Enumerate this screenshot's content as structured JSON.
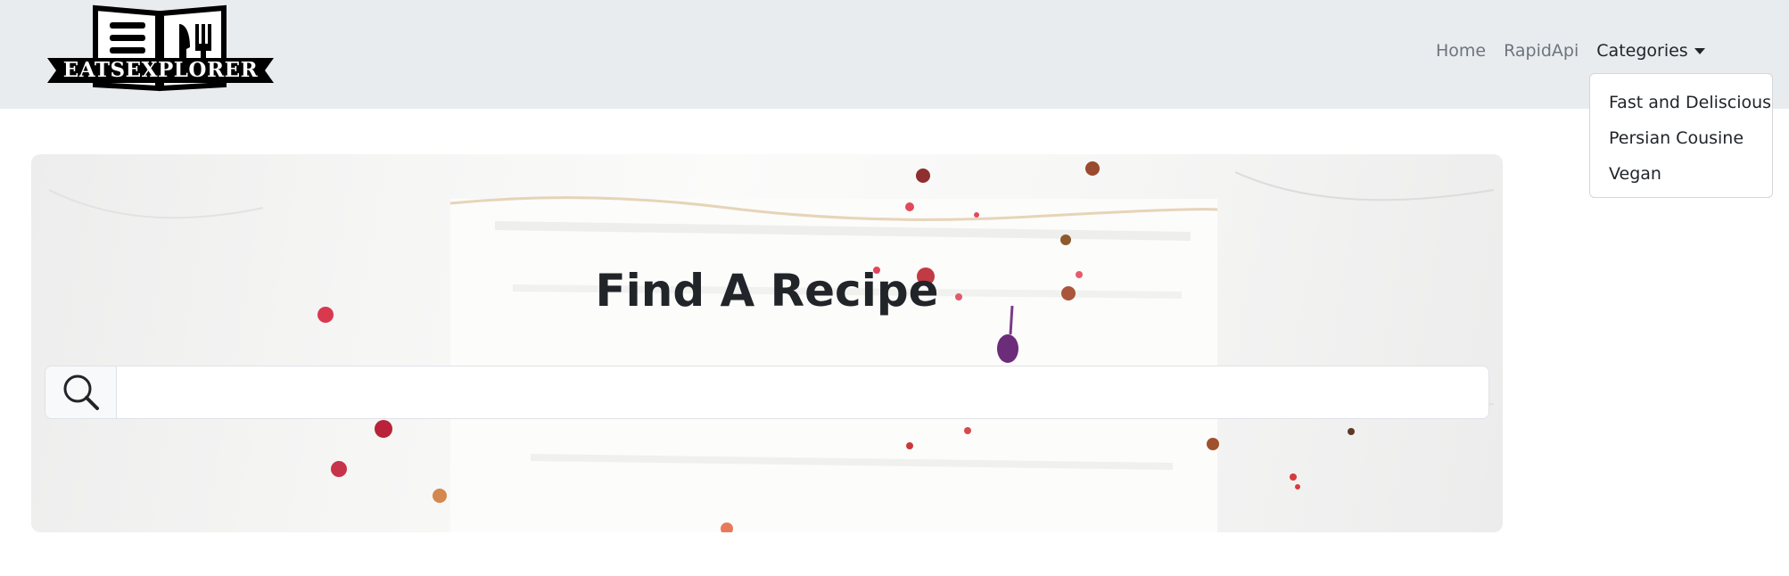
{
  "brand": {
    "logo_text": "EATSEXPLORER"
  },
  "nav": {
    "home": "Home",
    "rapidapi": "RapidApi",
    "categories": "Categories"
  },
  "dropdown": {
    "items": [
      "Fast and Deliscious",
      "Persian Cousine",
      "Vegan"
    ]
  },
  "hero": {
    "title": "Find A Recipe"
  },
  "search": {
    "value": "",
    "placeholder": ""
  },
  "colors": {
    "navbar_bg": "#e9ecef",
    "nav_link": "#6c757d",
    "text": "#212529"
  },
  "icons": {
    "search": "search-icon",
    "caret": "caret-down-icon",
    "logo": "book-fork-knife-icon"
  }
}
